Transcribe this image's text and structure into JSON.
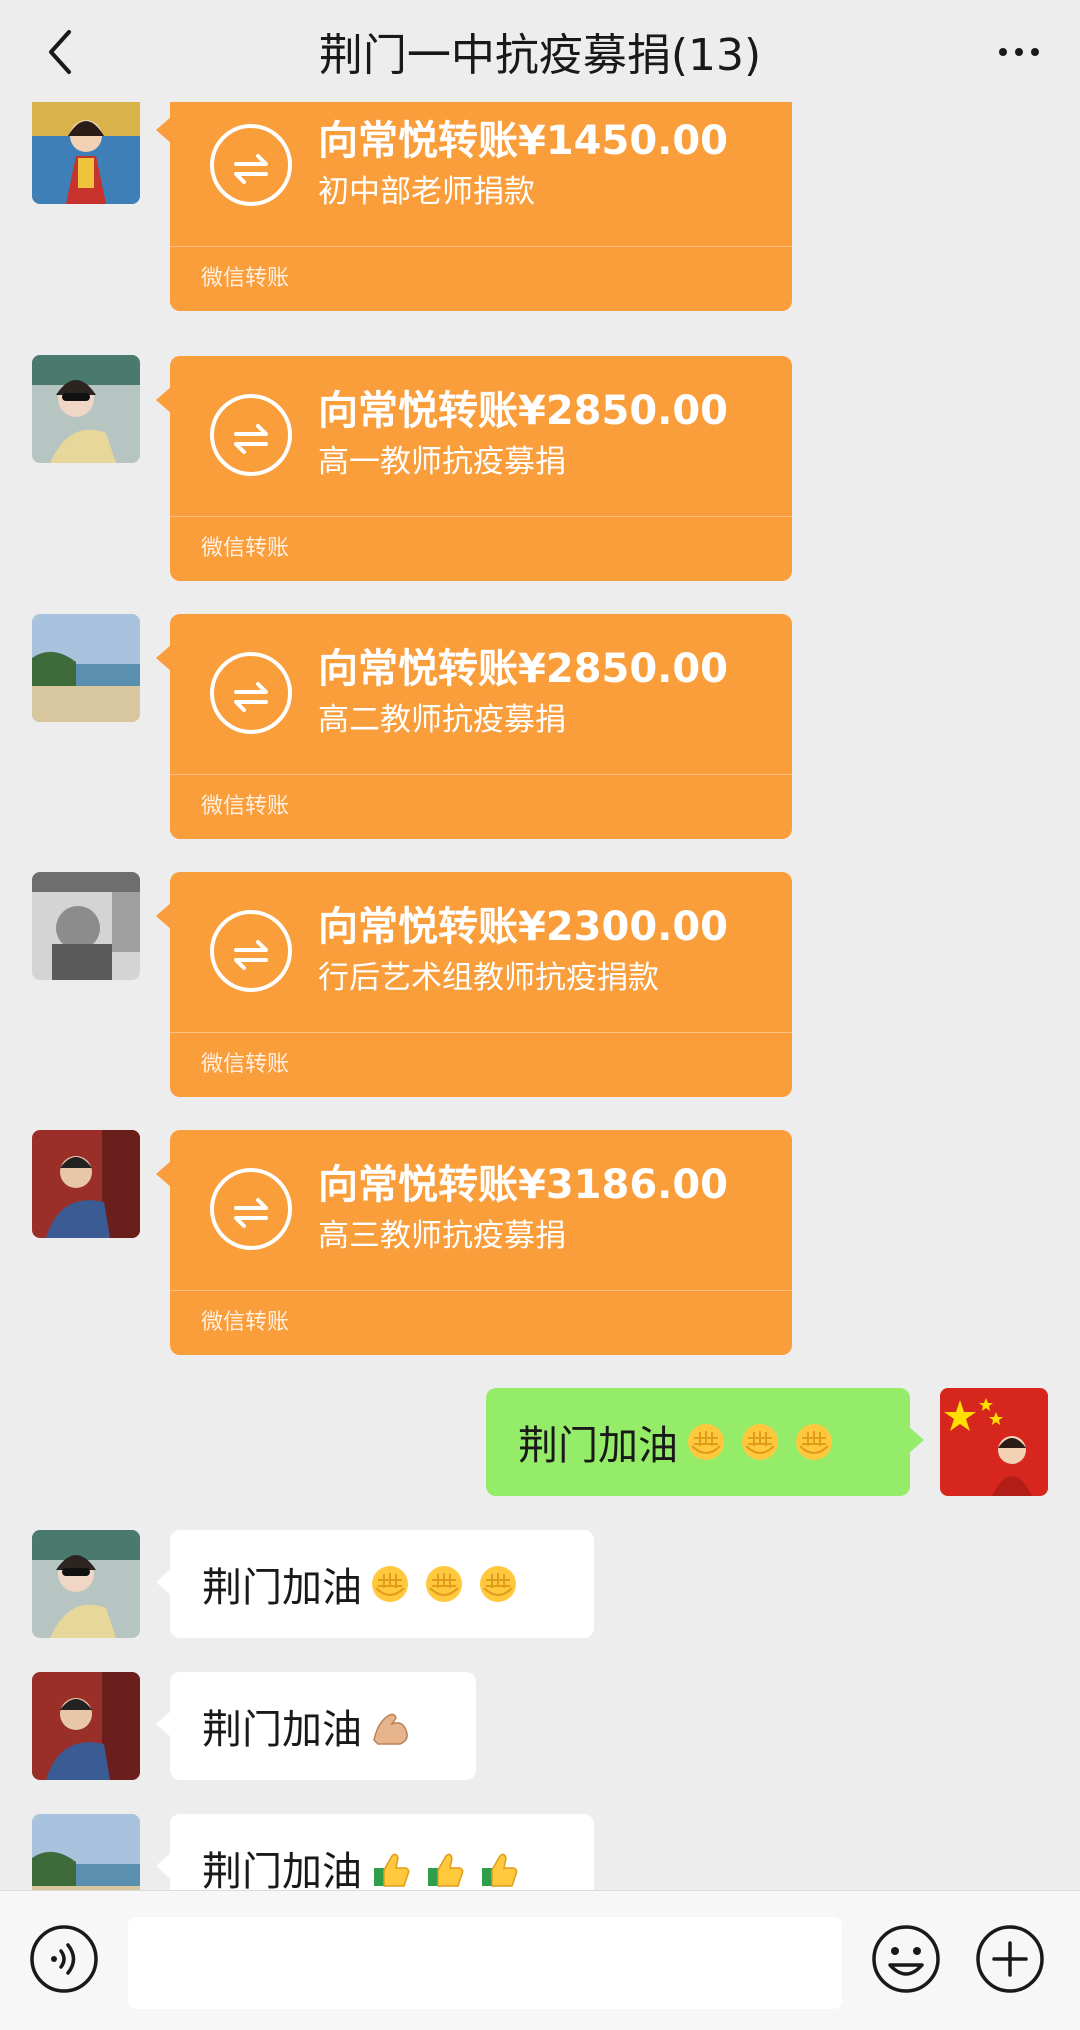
{
  "header": {
    "title": "荆门一中抗疫募捐(13)",
    "back_icon": "chevron-left-icon",
    "more_icon": "more-dots-icon"
  },
  "transfer_footer": "微信转账",
  "transfers": [
    {
      "amount": "向常悦转账¥1450.00",
      "note": "初中部老师捐款"
    },
    {
      "amount": "向常悦转账¥2850.00",
      "note": "高一教师抗疫募捐"
    },
    {
      "amount": "向常悦转账¥2850.00",
      "note": "高二教师抗疫募捐"
    },
    {
      "amount": "向常悦转账¥2300.00",
      "note": "行后艺术组教师抗疫捐款"
    },
    {
      "amount": "向常悦转账¥3186.00",
      "note": "高三教师抗疫募捐"
    }
  ],
  "messages": [
    {
      "text": "荆门加油",
      "emoji": "fist-emoji-x3",
      "side": "right"
    },
    {
      "text": "荆门加油",
      "emoji": "fist-emoji-x3",
      "side": "left"
    },
    {
      "text": "荆门加油",
      "emoji": "flexed-biceps-emoji",
      "side": "left"
    },
    {
      "text": "荆门加油",
      "emoji": "thumbs-up-emoji-x3",
      "side": "left"
    }
  ],
  "input_bar": {
    "voice_icon": "voice-icon",
    "emoji_icon": "emoji-icon",
    "plus_icon": "plus-icon",
    "input_value": ""
  },
  "colors": {
    "transfer_orange": "#fa9d3b",
    "self_bubble_green": "#95ec69",
    "background": "#ededed"
  }
}
